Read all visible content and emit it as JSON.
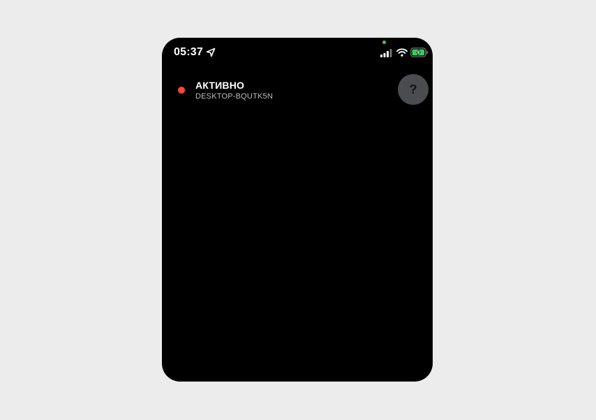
{
  "status_bar": {
    "time": "05:37",
    "location_icon": "location-arrow-icon",
    "signal_icon": "cellular-signal-icon",
    "wifi_icon": "wifi-icon",
    "battery_icon": "battery-charging-icon",
    "camera_indicator_color": "#30d158"
  },
  "session": {
    "status_color": "#ff453a",
    "title": "АКТИВНО",
    "device": "DESKTOP-BQUTK5N"
  },
  "help_button": {
    "label": "?"
  },
  "colors": {
    "background": "#000000",
    "page": "#ececec",
    "battery_fill": "#30d158",
    "help_button_bg": "#4a4c4f"
  }
}
